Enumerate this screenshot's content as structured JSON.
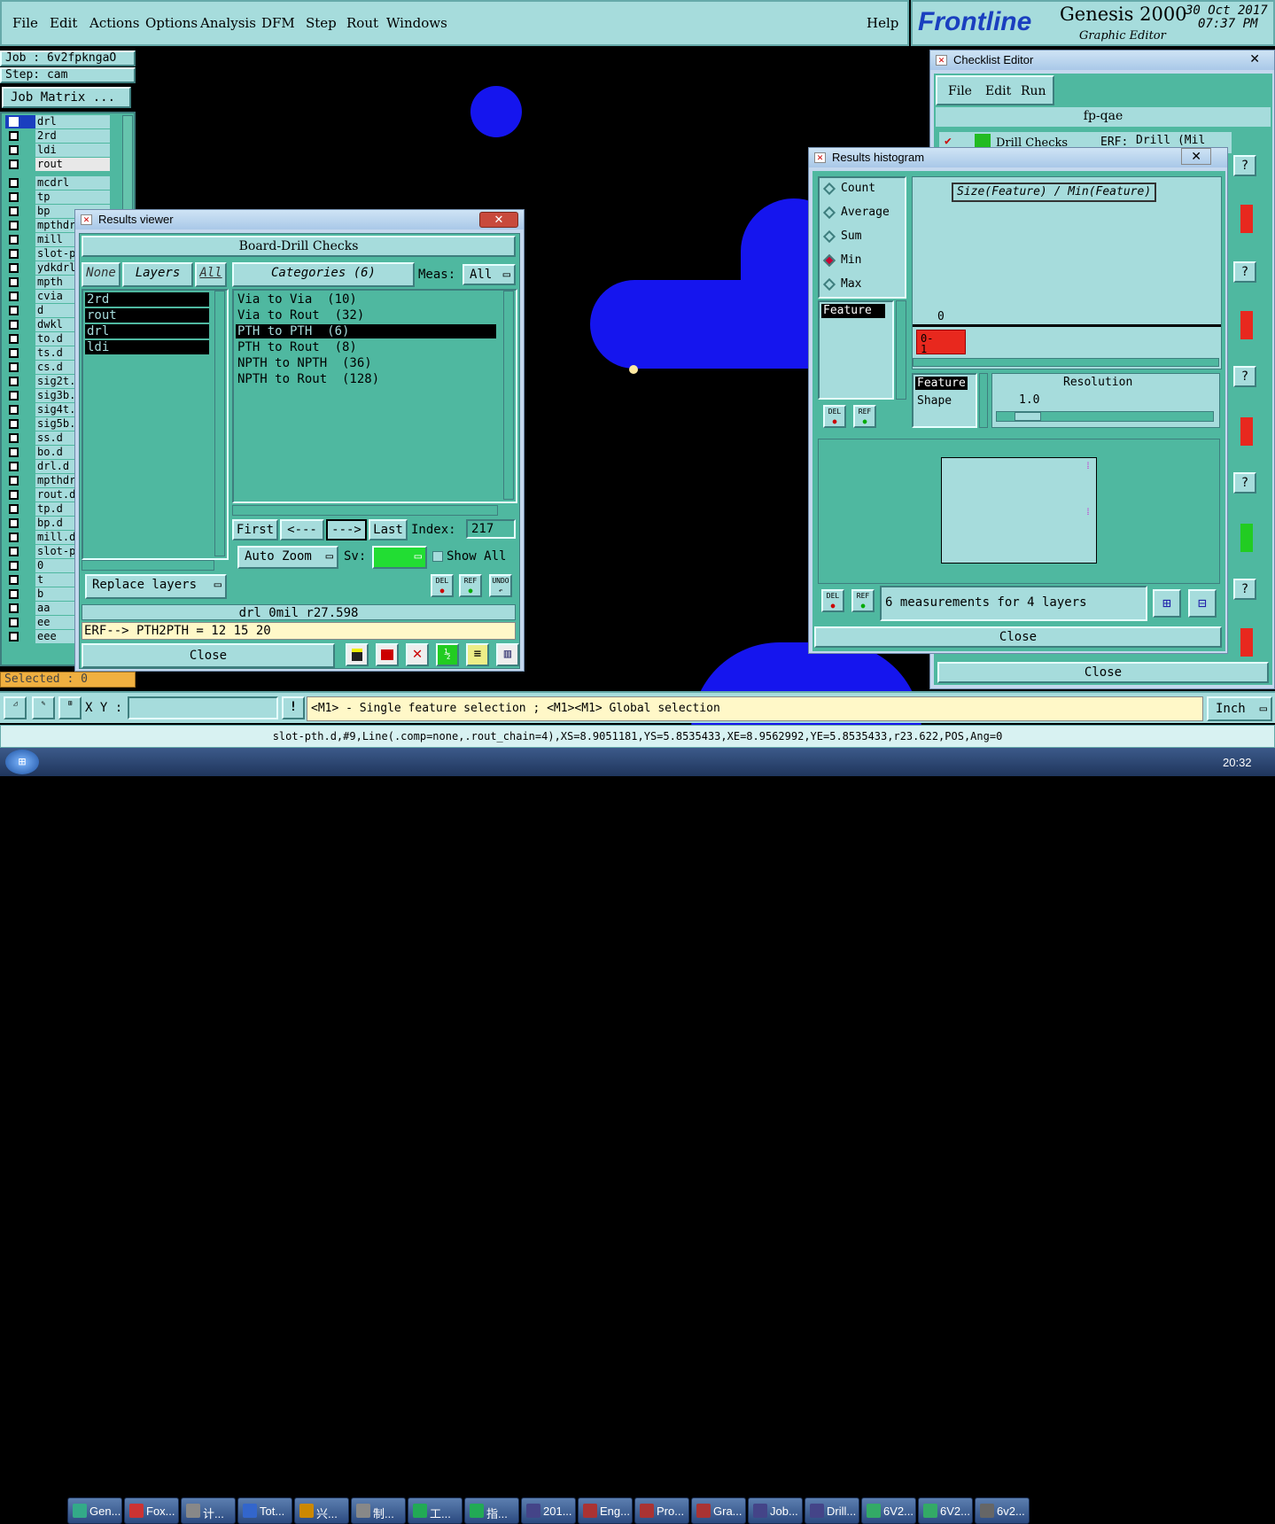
{
  "menubar": {
    "items": [
      "File",
      "Edit",
      "Actions",
      "Options",
      "Analysis",
      "DFM",
      "Step",
      "Rout",
      "Windows"
    ],
    "help": "Help"
  },
  "brand": {
    "logo": "Frontline",
    "product": "Genesis 2000",
    "subtitle": "Graphic Editor",
    "date": "30 Oct 2017",
    "time": "07:37 PM"
  },
  "job": {
    "job_label": "Job  : 6v2fpkngaO",
    "step_label": "Step: cam",
    "matrix_button": "Job Matrix ...",
    "selected": "Selected : 0"
  },
  "layers": [
    "drl",
    "2rd",
    "ldi",
    "rout",
    "mcdrl",
    "tp",
    "bp",
    "mpthdr",
    "mill",
    "slot-p",
    "ydkdrl",
    "mpth",
    "cvia",
    "d",
    "dwkl",
    "to.d",
    "ts.d",
    "cs.d",
    "sig2t.",
    "sig3b.",
    "sig4t.",
    "sig5b.",
    "ss.d",
    "bo.d",
    "drl.d",
    "mpthdr",
    "rout.d",
    "tp.d",
    "bp.d",
    "mill.d",
    "slot-p",
    "0",
    "t",
    "b",
    "aa",
    "ee",
    "eee"
  ],
  "results_viewer": {
    "title": "Results viewer",
    "header": "Board-Drill Checks",
    "none": "None",
    "layers_btn": "Layers",
    "all": "All",
    "categories": "Categories (6)",
    "meas_label": "Meas:",
    "meas_value": "All",
    "layer_list": [
      "2rd",
      "rout",
      "drl",
      "ldi"
    ],
    "category_list": [
      "Via to Via  (10)",
      "Via to Rout  (32)",
      "PTH to PTH  (6)",
      "PTH to Rout  (8)",
      "NPTH to NPTH  (36)",
      "NPTH to Rout  (128)"
    ],
    "first": "First",
    "prev": "<---",
    "next": "--->",
    "last": "Last",
    "index_label": "Index:",
    "index_value": "217",
    "auto_zoom": "Auto Zoom",
    "sv": "Sv:",
    "show_all": "Show All",
    "replace_layers": "Replace layers",
    "status": "drl 0mil  r27.598",
    "erf": "ERF--> PTH2PTH = 12 15 20",
    "close": "Close",
    "del": "DEL",
    "ref": "REF",
    "undo": "UNDO"
  },
  "checklist": {
    "title": "Checklist Editor",
    "menu": [
      "File",
      "Edit",
      "Run"
    ],
    "name": "fp-qae",
    "row": "Drill Checks",
    "erf": "ERF:",
    "drill": "Drill (Mil",
    "q": "?",
    "close": "Close"
  },
  "histogram": {
    "title": "Results histogram",
    "options": [
      "Count",
      "Average",
      "Sum",
      "Min",
      "Max"
    ],
    "selected": "Min",
    "feature_item": "Feature",
    "chart_title": "Size(Feature) / Min(Feature)",
    "zero": "0",
    "bar_label": "0-\n1",
    "side_list": [
      "Feature",
      "Shape"
    ],
    "resolution": "Resolution",
    "res_value": "1.0",
    "footer": "6 measurements for 4 layers",
    "close": "Close",
    "del": "DEL",
    "ref": "REF"
  },
  "bottom": {
    "xy_label": "X Y :",
    "hint": "<M1> - Single feature selection ; <M1><M1> Global selection",
    "units": "Inch",
    "feature_info": "slot-pth.d,#9,Line(.comp=none,.rout_chain=4),XS=8.9051181,YS=5.8535433,XE=8.9562992,YE=5.8535433,r23.622,POS,Ang=0"
  },
  "taskbar": {
    "items": [
      "Gen...",
      "Fox...",
      "计...",
      "Tot...",
      "兴...",
      "制...",
      "工...",
      "指...",
      "201...",
      "Eng...",
      "Pro...",
      "Gra...",
      "Job...",
      "Drill...",
      "6V2...",
      "6V2...",
      "6v2..."
    ],
    "clock": "20:32"
  },
  "colors": {
    "panel": "#a6dcdc",
    "dark_panel": "#4fb8a0",
    "feature": "#1515ee",
    "accent_red": "#e8281e"
  }
}
